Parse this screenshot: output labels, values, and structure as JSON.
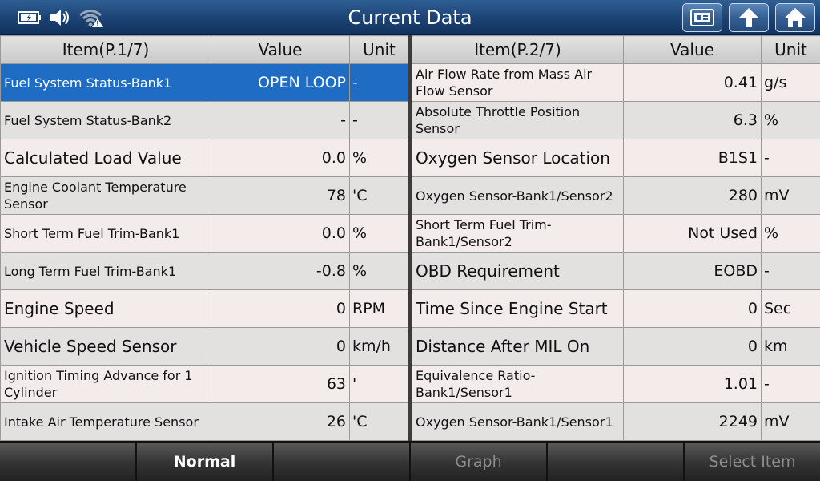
{
  "header": {
    "title": "Current Data",
    "icons": [
      "battery-icon",
      "speaker-icon",
      "wifi-warning-icon",
      "screenshot-icon",
      "back-icon",
      "home-icon"
    ]
  },
  "left_table": {
    "headers": {
      "item": "Item(P.1/7)",
      "value": "Value",
      "unit": "Unit"
    },
    "rows": [
      {
        "item": "Fuel System Status-Bank1",
        "value": "OPEN LOOP",
        "unit": "-",
        "selected": true
      },
      {
        "item": "Fuel System Status-Bank2",
        "value": "-",
        "unit": "-"
      },
      {
        "item": "Calculated Load Value",
        "value": "0.0",
        "unit": "%"
      },
      {
        "item": "Engine Coolant Temperature Sensor",
        "value": "78",
        "unit": "'C"
      },
      {
        "item": "Short Term Fuel Trim-Bank1",
        "value": "0.0",
        "unit": "%"
      },
      {
        "item": "Long Term Fuel Trim-Bank1",
        "value": "-0.8",
        "unit": "%"
      },
      {
        "item": "Engine Speed",
        "value": "0",
        "unit": "RPM"
      },
      {
        "item": "Vehicle Speed Sensor",
        "value": "0",
        "unit": "km/h"
      },
      {
        "item": "Ignition Timing Advance for 1 Cylinder",
        "value": "63",
        "unit": "'"
      },
      {
        "item": "Intake Air Temperature Sensor",
        "value": "26",
        "unit": "'C"
      }
    ]
  },
  "right_table": {
    "headers": {
      "item": "Item(P.2/7)",
      "value": "Value",
      "unit": "Unit"
    },
    "rows": [
      {
        "item": "Air Flow Rate from Mass Air Flow Sensor",
        "value": "0.41",
        "unit": "g/s"
      },
      {
        "item": "Absolute Throttle Position Sensor",
        "value": "6.3",
        "unit": "%"
      },
      {
        "item": "Oxygen Sensor Location",
        "value": "B1S1",
        "unit": "-"
      },
      {
        "item": "Oxygen Sensor-Bank1/Sensor2",
        "value": "280",
        "unit": "mV"
      },
      {
        "item": "Short Term Fuel Trim-Bank1/Sensor2",
        "value": "Not Used",
        "unit": "%"
      },
      {
        "item": "OBD Requirement",
        "value": "EOBD",
        "unit": "-"
      },
      {
        "item": "Time Since Engine Start",
        "value": "0",
        "unit": "Sec"
      },
      {
        "item": "Distance After MIL On",
        "value": "0",
        "unit": "km"
      },
      {
        "item": "Equivalence Ratio-Bank1/Sensor1",
        "value": "1.01",
        "unit": "-"
      },
      {
        "item": "Oxygen Sensor-Bank1/Sensor1",
        "value": "2249",
        "unit": "mV"
      }
    ]
  },
  "footer": {
    "buttons": [
      {
        "label": "",
        "enabled": false
      },
      {
        "label": "Normal",
        "enabled": true
      },
      {
        "label": "",
        "enabled": false
      },
      {
        "label": "Graph",
        "enabled": false
      },
      {
        "label": "",
        "enabled": false
      },
      {
        "label": "Select Item",
        "enabled": false
      }
    ]
  },
  "colors": {
    "title_bar": "#1d4476",
    "selected_row": "#1e6cc4",
    "row_odd": "#f4ebeb",
    "row_even": "#e3e0e0"
  }
}
